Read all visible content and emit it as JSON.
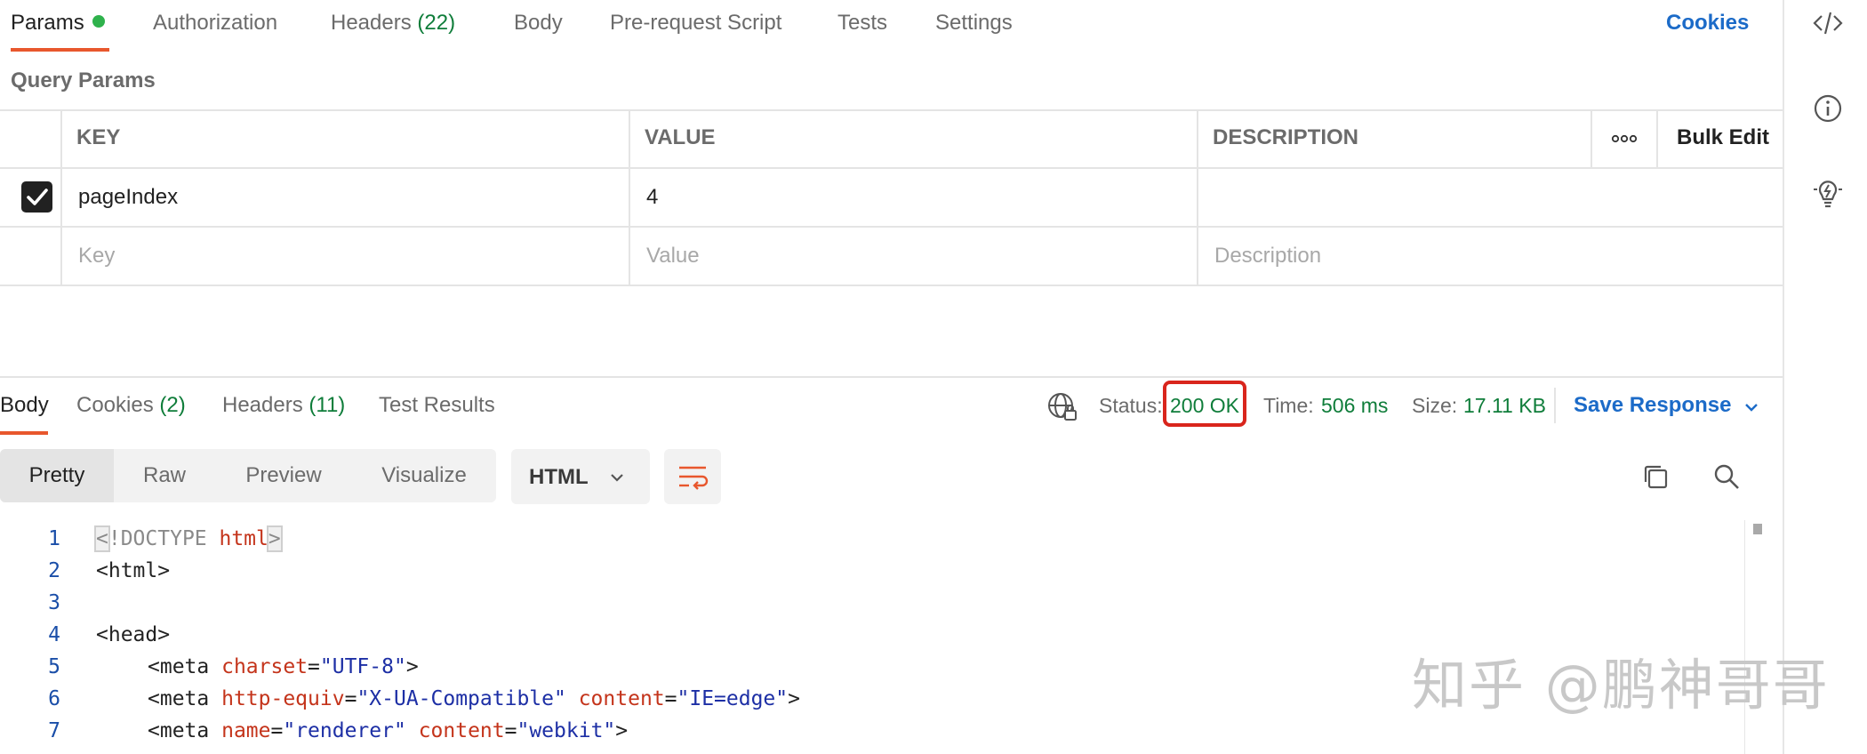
{
  "request_tabs": {
    "params": "Params",
    "authorization": "Authorization",
    "headers": "Headers",
    "headers_count": "(22)",
    "body": "Body",
    "pre_request": "Pre-request Script",
    "tests": "Tests",
    "settings": "Settings",
    "cookies": "Cookies"
  },
  "query_params": {
    "title": "Query Params",
    "columns": {
      "key": "KEY",
      "value": "VALUE",
      "description": "DESCRIPTION"
    },
    "bulk_edit": "Bulk Edit",
    "rows": [
      {
        "checked": true,
        "key": "pageIndex",
        "value": "4",
        "description": ""
      }
    ],
    "placeholders": {
      "key": "Key",
      "value": "Value",
      "description": "Description"
    }
  },
  "response": {
    "tabs": {
      "body": "Body",
      "cookies": "Cookies",
      "cookies_count": "(2)",
      "headers": "Headers",
      "headers_count": "(11)",
      "test_results": "Test Results"
    },
    "status_label": "Status:",
    "status_value": "200 OK",
    "time_label": "Time:",
    "time_value": "506 ms",
    "size_label": "Size:",
    "size_value": "17.11 KB",
    "save_response": "Save Response"
  },
  "view": {
    "modes": [
      "Pretty",
      "Raw",
      "Preview",
      "Visualize"
    ],
    "active_mode": "Pretty",
    "format": "HTML"
  },
  "code": {
    "line_numbers": [
      "1",
      "2",
      "3",
      "4",
      "5",
      "6",
      "7"
    ],
    "l1_lt": "<",
    "l1_doctype": "!DOCTYPE ",
    "l1_html": "html",
    "l1_gt": ">",
    "l2": "<html>",
    "l4": "<head>",
    "meta_open": "<meta ",
    "gt": ">",
    "eq": "=",
    "sp": " ",
    "l5_attr": "charset",
    "l5_val": "\"UTF-8\"",
    "l6_attr1": "http-equiv",
    "l6_val1": "\"X-UA-Compatible\"",
    "l6_attr2": "content",
    "l6_val2": "\"IE=edge\"",
    "l7_attr1": "name",
    "l7_val1": "\"renderer\"",
    "l7_attr2": "content",
    "l7_val2": "\"webkit\""
  },
  "watermark": "知乎 @鹏神哥哥"
}
